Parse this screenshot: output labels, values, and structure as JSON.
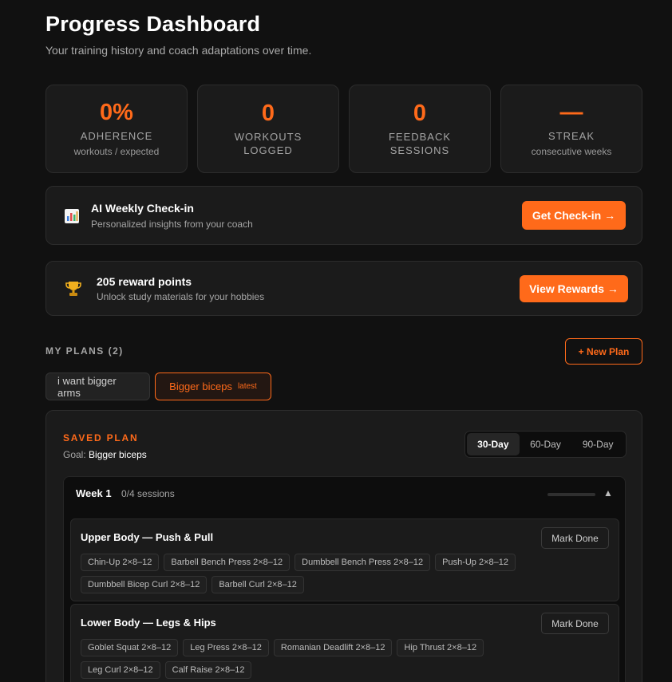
{
  "header": {
    "title": "Progress Dashboard",
    "subtitle": "Your training history and coach adaptations over time."
  },
  "stats": [
    {
      "value": "0%",
      "label": "ADHERENCE",
      "sub": "workouts / expected"
    },
    {
      "value": "0",
      "label": "WORKOUTS LOGGED",
      "sub": ""
    },
    {
      "value": "0",
      "label": "FEEDBACK SESSIONS",
      "sub": ""
    },
    {
      "value": "—",
      "label": "STREAK",
      "sub": "consecutive weeks"
    }
  ],
  "checkin": {
    "icon": "chart-icon",
    "title": "AI Weekly Check-in",
    "subtitle": "Personalized insights from your coach",
    "button": "Get Check-in →"
  },
  "rewards": {
    "icon": "trophy-icon",
    "title": "205 reward points",
    "subtitle": "Unlock study materials for your hobbies",
    "button": "View Rewards →"
  },
  "plans": {
    "label": "MY PLANS (2)",
    "new_button": "+ New Plan",
    "tabs": [
      {
        "label": "i want bigger arms",
        "badge": ""
      },
      {
        "label": "Bigger biceps",
        "badge": "latest"
      }
    ]
  },
  "saved_plan": {
    "label": "SAVED PLAN",
    "goal_label": "Goal:",
    "goal_value": "Bigger biceps",
    "durations": [
      "30-Day",
      "60-Day",
      "90-Day"
    ],
    "active_duration": "30-Day",
    "week": {
      "title": "Week 1",
      "sessions_text": "0/4 sessions",
      "progress": 0,
      "sessions": [
        {
          "title": "Upper Body — Push & Pull",
          "mark_done": "Mark Done",
          "exercises": [
            "Chin-Up 2×8–12",
            "Barbell Bench Press 2×8–12",
            "Dumbbell Bench Press 2×8–12",
            "Push-Up 2×8–12",
            "Dumbbell Bicep Curl 2×8–12",
            "Barbell Curl 2×8–12"
          ]
        },
        {
          "title": "Lower Body — Legs & Hips",
          "mark_done": "Mark Done",
          "exercises": [
            "Goblet Squat 2×8–12",
            "Leg Press 2×8–12",
            "Romanian Deadlift 2×8–12",
            "Hip Thrust 2×8–12",
            "Leg Curl 2×8–12",
            "Calf Raise 2×8–12"
          ]
        }
      ]
    }
  },
  "colors": {
    "accent": "#ff6a1a",
    "background": "#111111",
    "card": "#1b1b1b"
  }
}
